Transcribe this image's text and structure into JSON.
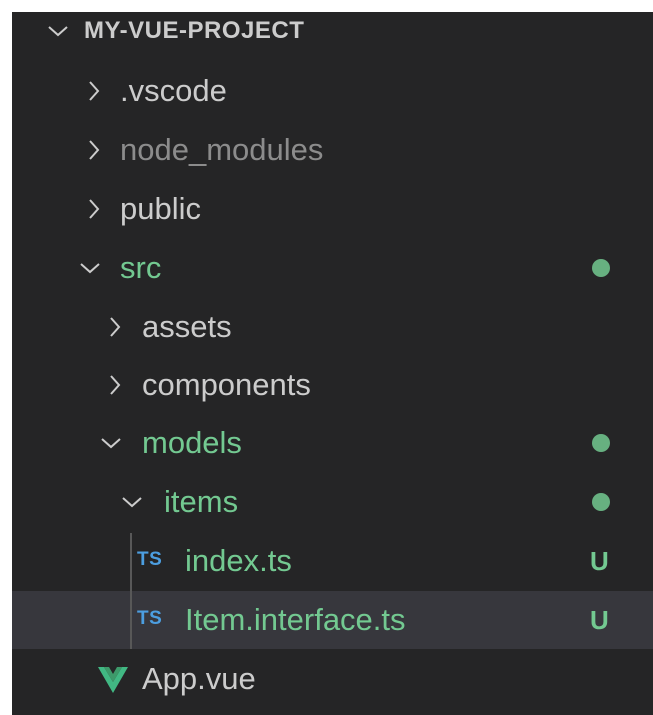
{
  "explorer": {
    "root": {
      "label": "MY-VUE-PROJECT",
      "expanded": true
    },
    "items": [
      {
        "label": ".vscode",
        "type": "folder",
        "expanded": false
      },
      {
        "label": "node_modules",
        "type": "folder",
        "expanded": false,
        "status": "ignored"
      },
      {
        "label": "public",
        "type": "folder",
        "expanded": false
      },
      {
        "label": "src",
        "type": "folder",
        "expanded": true,
        "status": "untracked"
      },
      {
        "label": "assets",
        "type": "folder",
        "expanded": false
      },
      {
        "label": "components",
        "type": "folder",
        "expanded": false
      },
      {
        "label": "models",
        "type": "folder",
        "expanded": true,
        "status": "untracked"
      },
      {
        "label": "items",
        "type": "folder",
        "expanded": true,
        "status": "untracked"
      },
      {
        "label": "index.ts",
        "type": "file",
        "icon": "TS",
        "badge": "U",
        "status": "untracked"
      },
      {
        "label": "Item.interface.ts",
        "type": "file",
        "icon": "TS",
        "badge": "U",
        "status": "untracked",
        "selected": true
      },
      {
        "label": "App.vue",
        "type": "file",
        "icon": "vue-icon"
      }
    ]
  },
  "colors": {
    "background": "#252526",
    "selected_row": "#37373d",
    "untracked": "#73c991",
    "ignored": "#8c8c8c",
    "ts_icon": "#4c9ee0",
    "vue_icon": "#41b883"
  }
}
